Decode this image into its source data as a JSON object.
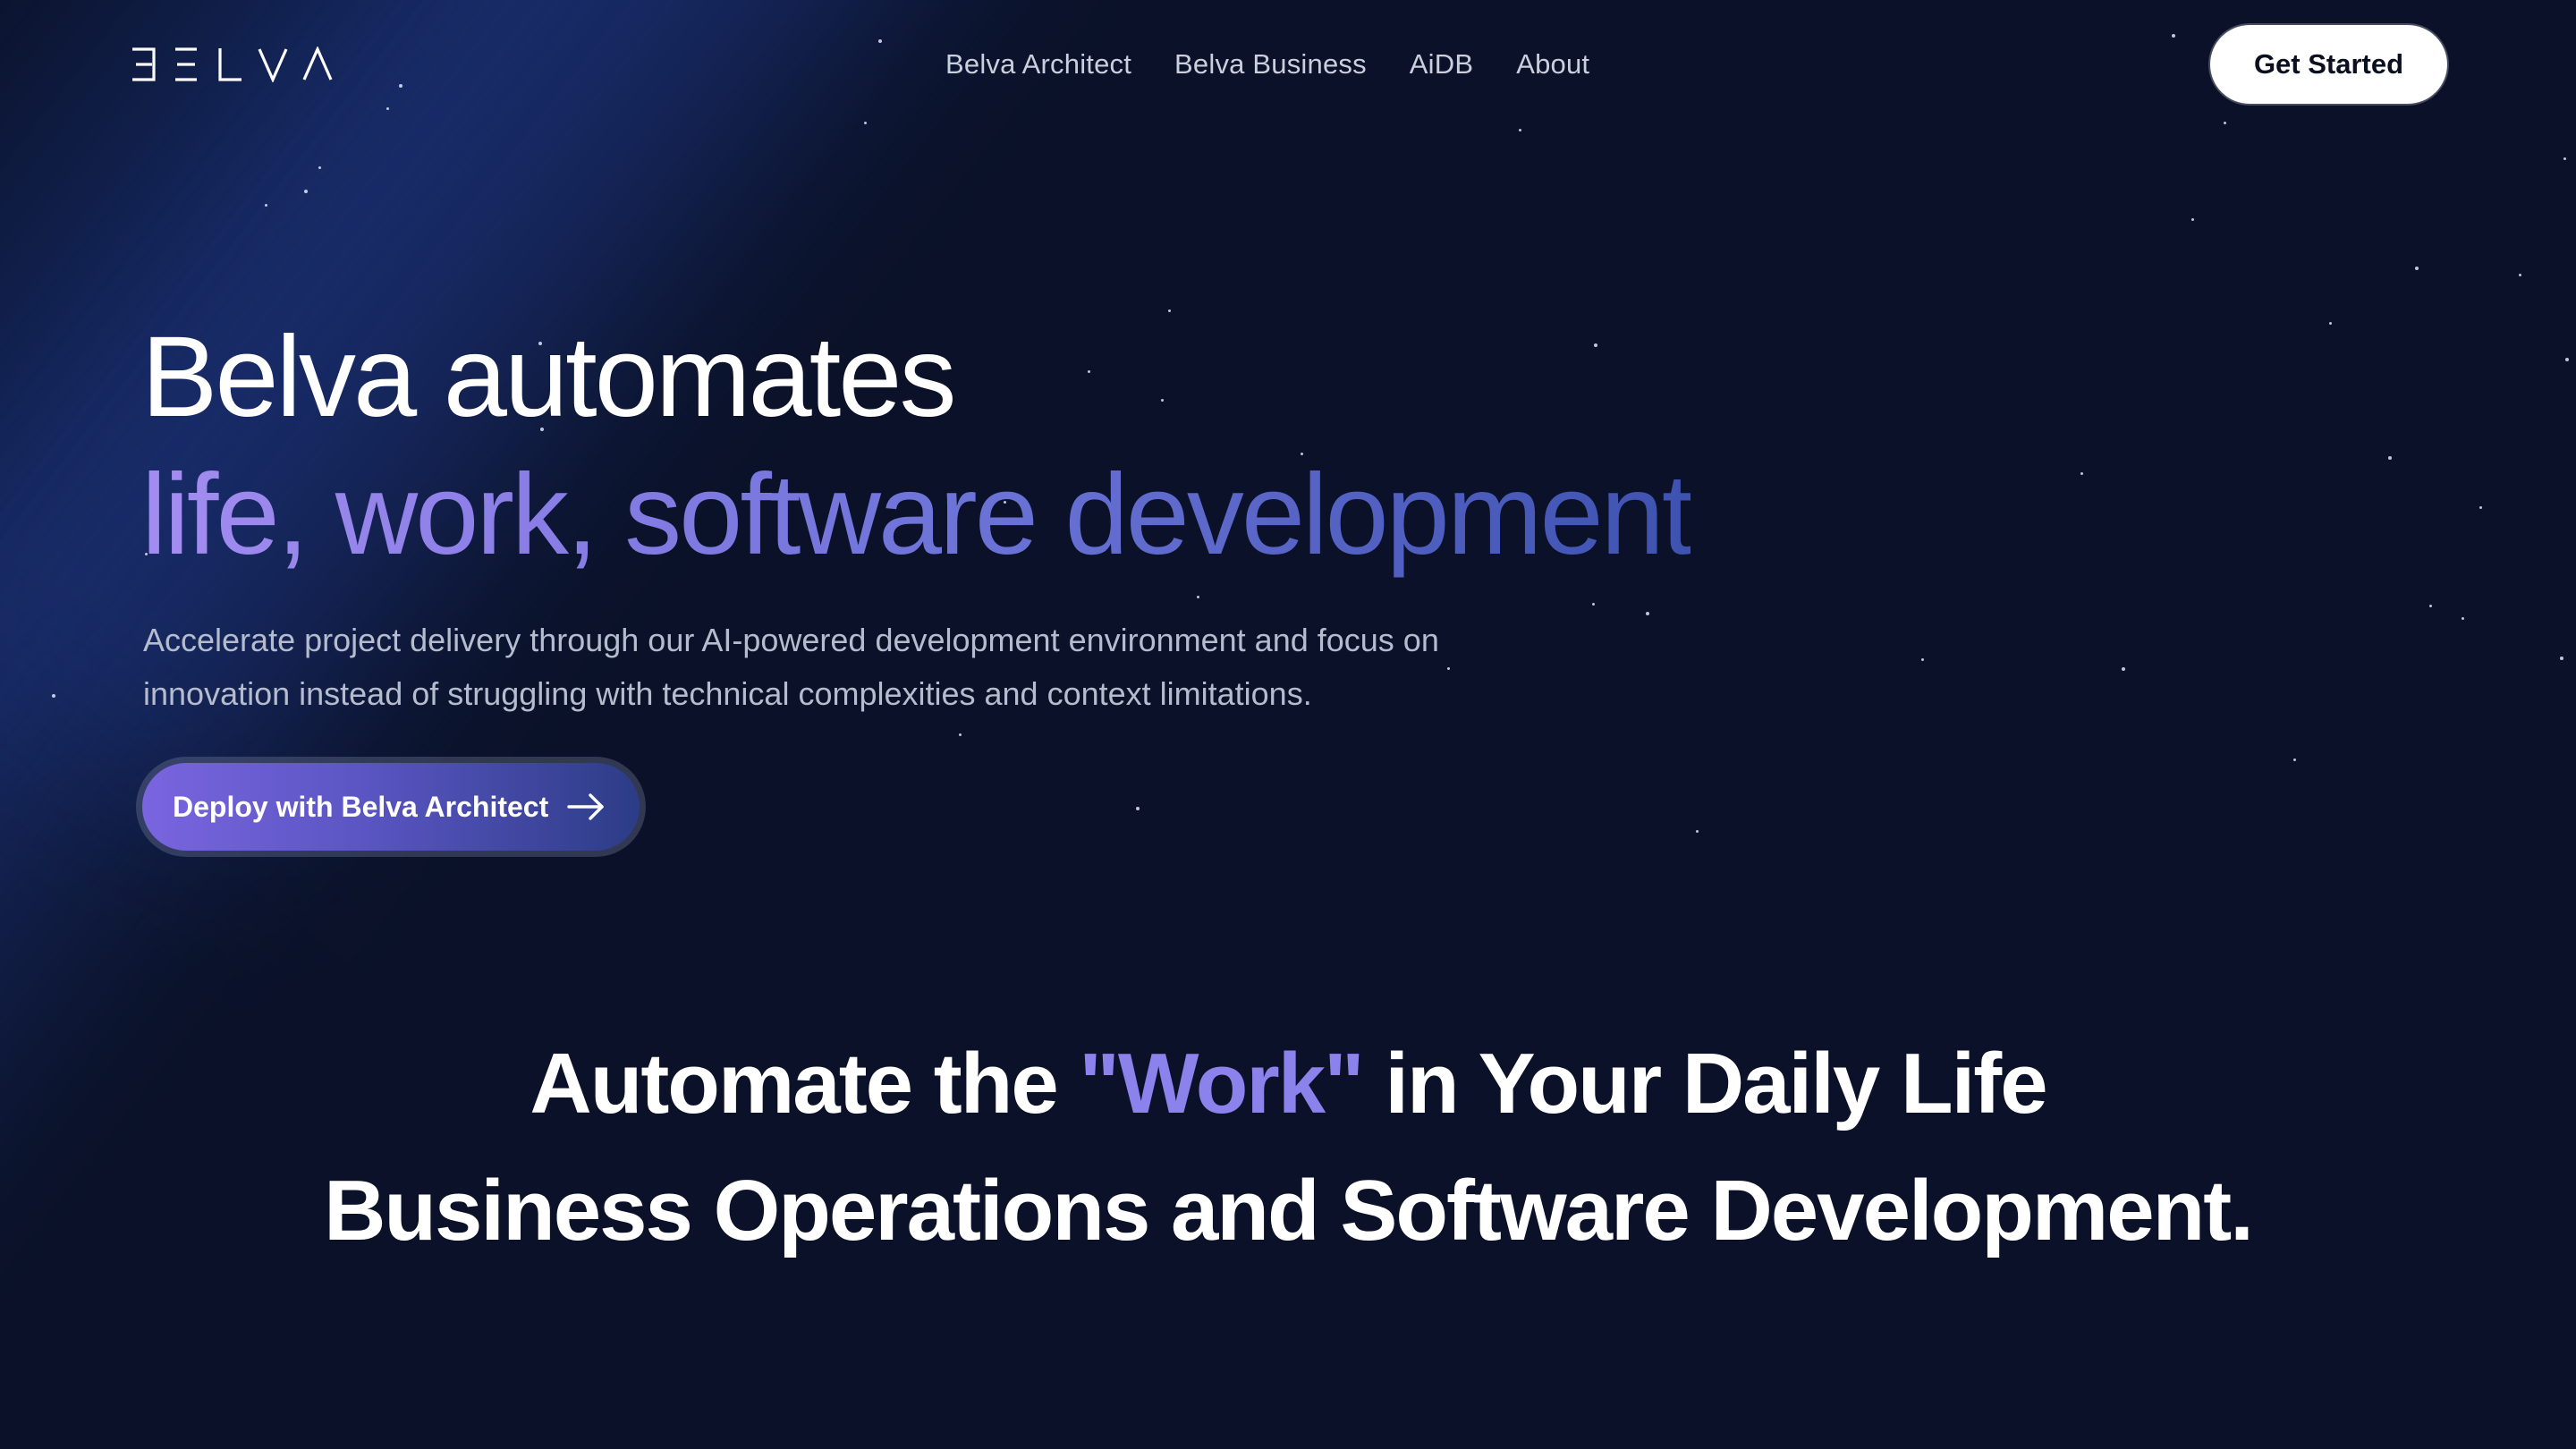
{
  "brand": {
    "logo_text": "BELVA"
  },
  "nav": {
    "items": [
      {
        "label": "Belva Architect"
      },
      {
        "label": "Belva Business"
      },
      {
        "label": "AiDB"
      },
      {
        "label": "About"
      }
    ],
    "cta_label": "Get Started"
  },
  "hero": {
    "title_line1": "Belva automates",
    "title_line2": "life, work, software development",
    "subtitle_line1": "Accelerate project delivery through our AI-powered development environment and focus on",
    "subtitle_line2": "innovation instead of struggling with technical complexities and context limitations.",
    "button_label": "Deploy with Belva Architect",
    "button_icon": "arrow-right-icon"
  },
  "section": {
    "headline_pre": "Automate the ",
    "headline_accent": "\"Work\"",
    "headline_post": " in Your Daily Life",
    "headline_line2": "Business Operations and Software Development."
  },
  "colors": {
    "background": "#0a1128",
    "accent_purple": "#8b82ec",
    "gradient_start": "#a48df0",
    "gradient_end": "#3e52b0",
    "cta_bg": "#ffffff"
  }
}
